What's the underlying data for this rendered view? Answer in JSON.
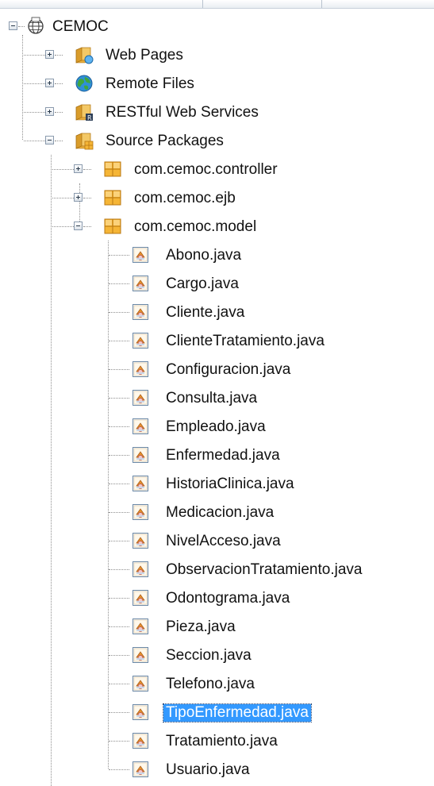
{
  "tree": {
    "root": {
      "label": "CEMOC",
      "icon": "globe-project-icon"
    },
    "top_nodes": [
      {
        "label": "Web Pages",
        "icon": "folder-web-icon"
      },
      {
        "label": "Remote Files",
        "icon": "remote-globe-icon"
      },
      {
        "label": "RESTful Web Services",
        "icon": "folder-rest-icon"
      },
      {
        "label": "Source Packages",
        "icon": "folder-package-icon"
      }
    ],
    "packages": [
      {
        "label": "com.cemoc.controller",
        "icon": "package-icon"
      },
      {
        "label": "com.cemoc.ejb",
        "icon": "package-icon"
      },
      {
        "label": "com.cemoc.model",
        "icon": "package-icon"
      }
    ],
    "files": [
      {
        "label": "Abono.java"
      },
      {
        "label": "Cargo.java"
      },
      {
        "label": "Cliente.java"
      },
      {
        "label": "ClienteTratamiento.java"
      },
      {
        "label": "Configuracion.java"
      },
      {
        "label": "Consulta.java"
      },
      {
        "label": "Empleado.java"
      },
      {
        "label": "Enfermedad.java"
      },
      {
        "label": "HistoriaClinica.java"
      },
      {
        "label": "Medicacion.java"
      },
      {
        "label": "NivelAcceso.java"
      },
      {
        "label": "ObservacionTratamiento.java"
      },
      {
        "label": "Odontograma.java"
      },
      {
        "label": "Pieza.java"
      },
      {
        "label": "Seccion.java"
      },
      {
        "label": "Telefono.java"
      },
      {
        "label": "TipoEnfermedad.java",
        "selected": true
      },
      {
        "label": "Tratamiento.java"
      },
      {
        "label": "Usuario.java"
      }
    ]
  },
  "colors": {
    "selection": "#3399ff",
    "package": "#e8a020",
    "folder": "#e9b84a"
  }
}
